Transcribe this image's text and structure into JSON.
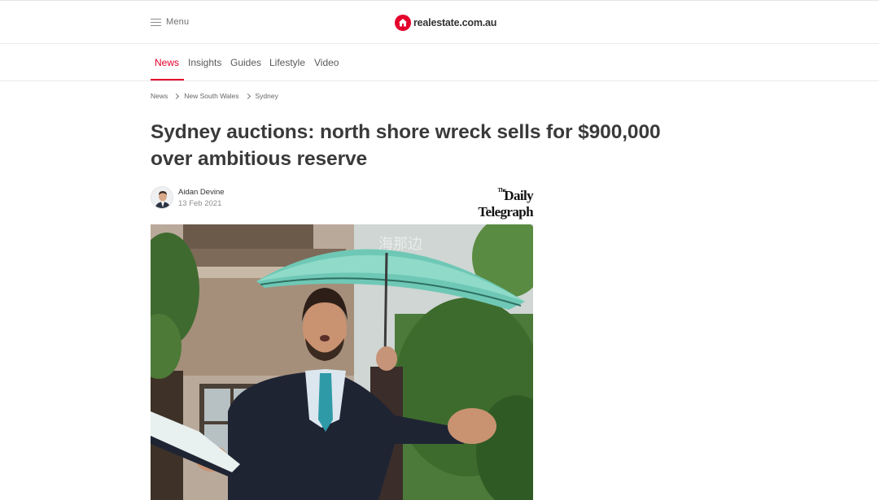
{
  "header": {
    "menu_label": "Menu",
    "logo_text": "realestate.com.au",
    "brand_color": "#e4002b"
  },
  "nav": {
    "items": [
      "News",
      "Insights",
      "Guides",
      "Lifestyle",
      "Video"
    ],
    "active": "News"
  },
  "breadcrumb": [
    "News",
    "New South Wales",
    "Sydney"
  ],
  "article": {
    "headline_line1": "Sydney auctions: north shore wreck sells for $900,000",
    "headline_line2": "over ambitious reserve",
    "author": "Aidan Devine",
    "date": "13 Feb 2021",
    "publisher_prefix": "The",
    "publisher_name": "Daily Telegraph",
    "hero_watermark": "海那边"
  },
  "icons": {
    "menu": "hamburger-icon",
    "logo": "house-logo-icon",
    "breadcrumb_separator": "chevron-right-icon"
  }
}
